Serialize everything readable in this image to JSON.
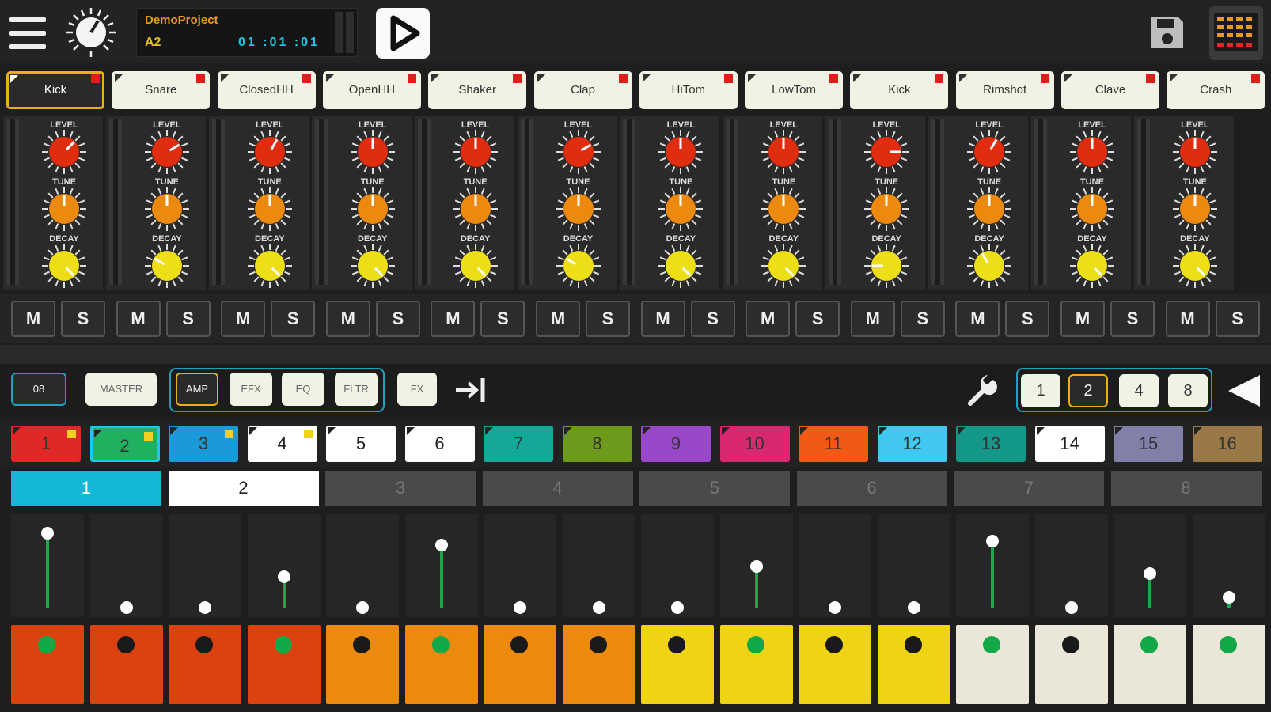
{
  "topbar": {
    "menu_icon": "hamburger-menu-icon",
    "tempo_icon": "tempo-knob-icon",
    "project_name": "DemoProject",
    "pattern_name": "A2",
    "position": "01 :01 :01",
    "play_icon": "play-icon",
    "save_icon": "floppy-disk-icon",
    "mixer_icon": "mixer-grid-icon"
  },
  "instruments": [
    {
      "label": "Kick",
      "selected": true
    },
    {
      "label": "Snare"
    },
    {
      "label": "ClosedHH"
    },
    {
      "label": "OpenHH"
    },
    {
      "label": "Shaker"
    },
    {
      "label": "Clap"
    },
    {
      "label": "HiTom"
    },
    {
      "label": "LowTom"
    },
    {
      "label": "Kick"
    },
    {
      "label": "Rimshot"
    },
    {
      "label": "Clave"
    },
    {
      "label": "Crash"
    }
  ],
  "knob_labels": {
    "level": "LEVEL",
    "tune": "TUNE",
    "decay": "DECAY"
  },
  "ms": {
    "mute": "M",
    "solo": "S"
  },
  "modes": {
    "track_btn": "08",
    "master": "MASTER",
    "amp": "AMP",
    "efx": "EFX",
    "eq": "EQ",
    "fltr": "FLTR",
    "fx": "FX",
    "export_icon": "arrow-to-line-icon",
    "settings_icon": "wrench-icon",
    "collapse_icon": "triangle-left-icon"
  },
  "lengths": {
    "options": [
      "1",
      "2",
      "4",
      "8"
    ],
    "selected": "2"
  },
  "patterns": [
    {
      "label": "1",
      "color": "#e02828",
      "marker": true
    },
    {
      "label": "2",
      "color": "#20b060",
      "marker": true,
      "selected": true
    },
    {
      "label": "3",
      "color": "#1a9ad8",
      "marker": true
    },
    {
      "label": "4",
      "color": "#ffffff",
      "marker": true
    },
    {
      "label": "5",
      "color": "#ffffff"
    },
    {
      "label": "6",
      "color": "#ffffff"
    },
    {
      "label": "7",
      "color": "#14a898"
    },
    {
      "label": "8",
      "color": "#6e9a1c"
    },
    {
      "label": "9",
      "color": "#9848c8"
    },
    {
      "label": "10",
      "color": "#d82870"
    },
    {
      "label": "11",
      "color": "#f05a14"
    },
    {
      "label": "12",
      "color": "#40c8f0"
    },
    {
      "label": "13",
      "color": "#14988a"
    },
    {
      "label": "14",
      "color": "#ffffff"
    },
    {
      "label": "15",
      "color": "#8080a8"
    },
    {
      "label": "16",
      "color": "#9a7848"
    }
  ],
  "bars": [
    {
      "label": "1",
      "state": "playing"
    },
    {
      "label": "2",
      "state": "active"
    },
    {
      "label": "3",
      "state": "inactive"
    },
    {
      "label": "4",
      "state": "inactive"
    },
    {
      "label": "5",
      "state": "inactive"
    },
    {
      "label": "6",
      "state": "inactive"
    },
    {
      "label": "7",
      "state": "inactive"
    },
    {
      "label": "8",
      "state": "inactive"
    }
  ],
  "steps": [
    {
      "on": true,
      "velocity": 0.85
    },
    {
      "on": false,
      "velocity": 0
    },
    {
      "on": false,
      "velocity": 0
    },
    {
      "on": true,
      "velocity": 0.35
    },
    {
      "on": false,
      "velocity": 0
    },
    {
      "on": true,
      "velocity": 0.72
    },
    {
      "on": false,
      "velocity": 0
    },
    {
      "on": false,
      "velocity": 0
    },
    {
      "on": false,
      "velocity": 0
    },
    {
      "on": true,
      "velocity": 0.47
    },
    {
      "on": false,
      "velocity": 0
    },
    {
      "on": false,
      "velocity": 0
    },
    {
      "on": true,
      "velocity": 0.76
    },
    {
      "on": false,
      "velocity": 0
    },
    {
      "on": true,
      "velocity": 0.39
    },
    {
      "on": true,
      "velocity": 0.12
    }
  ],
  "step_group_colors": [
    "#dc4210",
    "#ec8a10",
    "#eed414",
    "#ebe7d8"
  ]
}
